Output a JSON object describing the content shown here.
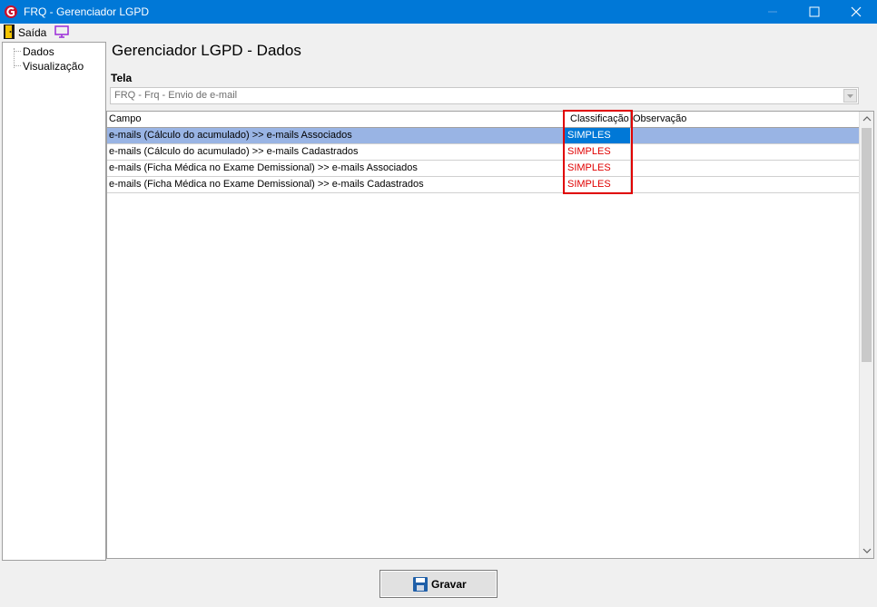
{
  "window": {
    "title": "FRQ - Gerenciador LGPD"
  },
  "menu": {
    "exit_label": "Saída"
  },
  "tree": {
    "items": [
      "Dados",
      "Visualização"
    ]
  },
  "page": {
    "title": "Gerenciador LGPD - Dados",
    "tela_label": "Tela"
  },
  "tela_combo": {
    "value": "FRQ - Frq - Envio de e-mail"
  },
  "grid": {
    "columns": [
      "Campo",
      "Classificação",
      "Observação"
    ],
    "rows": [
      {
        "campo": "e-mails (Cálculo do acumulado)  >> e-mails Associados",
        "classificacao": "SIMPLES",
        "observacao": ""
      },
      {
        "campo": "e-mails (Cálculo do acumulado) >> e-mails Cadastrados",
        "classificacao": "SIMPLES",
        "observacao": ""
      },
      {
        "campo": "e-mails (Ficha Médica no Exame Demissional) >> e-mails Associados",
        "classificacao": "SIMPLES",
        "observacao": ""
      },
      {
        "campo": "e-mails (Ficha Médica no Exame Demissional) >> e-mails Cadastrados",
        "classificacao": "SIMPLES",
        "observacao": ""
      }
    ],
    "selected_row": 0
  },
  "footer": {
    "save_label": "Gravar"
  },
  "colors": {
    "titlebar": "#0078d7",
    "highlight": "#e00000",
    "selected_row": "#99b4e4"
  }
}
